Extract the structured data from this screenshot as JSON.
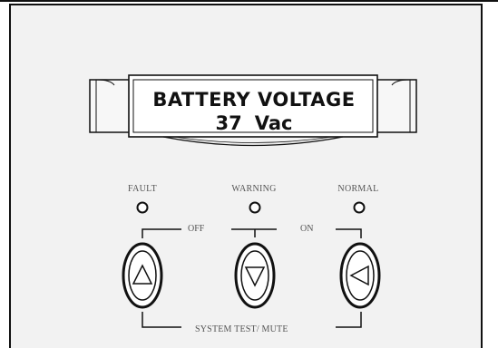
{
  "display": {
    "line1": "BATTERY  VOLTAGE",
    "value": "37",
    "unit": "Vac"
  },
  "indicators": [
    {
      "label": "FAULT"
    },
    {
      "label": "WARNING"
    },
    {
      "label": "NORMAL"
    }
  ],
  "control_labels": {
    "off": "OFF",
    "on": "ON",
    "system_test": "SYSTEM TEST/ MUTE"
  },
  "buttons": [
    {
      "icon": "triangle-up-icon"
    },
    {
      "icon": "triangle-down-icon"
    },
    {
      "icon": "triangle-left-icon"
    }
  ]
}
